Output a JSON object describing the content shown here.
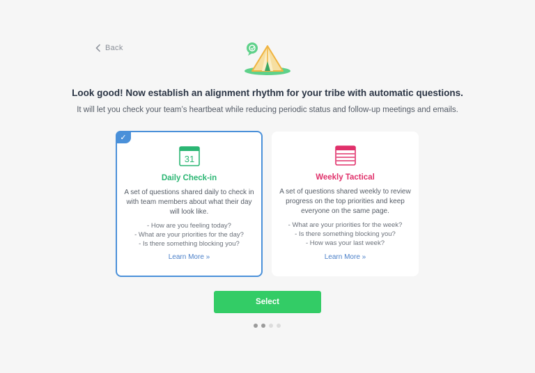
{
  "nav": {
    "back_label": "Back"
  },
  "header": {
    "title": "Look good! Now establish an alignment rhythm for your tribe with automatic questions.",
    "subtitle": "It will let you check your team’s heartbeat while reducing periodic status and follow-up meetings and emails."
  },
  "cards": [
    {
      "icon": "calendar-31-icon",
      "calendar_day": "31",
      "title": "Daily Check-in",
      "description": "A set of questions shared daily to check in with team members about what their day will look like.",
      "questions": [
        "- How are you feeling today?",
        "- What are your priorities for the day?",
        "- Is there something blocking you?"
      ],
      "learn_more": "Learn More »",
      "selected": true,
      "accent": "#2bb673"
    },
    {
      "icon": "weekly-calendar-icon",
      "title": "Weekly Tactical",
      "description": "A set of questions shared weekly to review progress on the top priorities and keep everyone on the same page.",
      "questions": [
        "- What are your priorities for the week?",
        "- Is there something blocking you?",
        "- How was your last week?"
      ],
      "learn_more": "Learn More »",
      "selected": false,
      "accent": "#e0306a"
    }
  ],
  "actions": {
    "select_label": "Select"
  },
  "pagination": {
    "total": 4,
    "active_index": 1
  },
  "colors": {
    "selected_border": "#4a90d9",
    "button": "#33cc66",
    "link": "#4a7fc8"
  }
}
